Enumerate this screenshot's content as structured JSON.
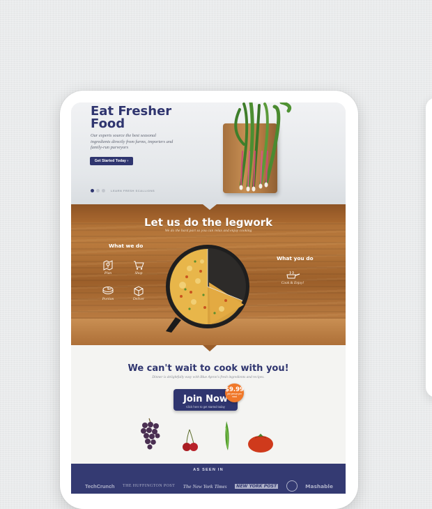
{
  "hero": {
    "title": "Eat Fresher Food",
    "subtitle": "Our experts source the best seasonal ingredients directly from farms, importers and family-run purveyors",
    "cta_label": "Get Started Today ›",
    "carousel_label": "LEARN FRESH SCALLIONS"
  },
  "legwork": {
    "title": "Let us do the legwork",
    "subtitle": "We do the hard part so you can relax and enjoy cooking",
    "we_do_title": "What we do",
    "you_do_title": "What you do",
    "we_do_steps": [
      {
        "label": "Plan",
        "icon": "map-pin-icon"
      },
      {
        "label": "Shop",
        "icon": "cart-icon"
      },
      {
        "label": "Portion",
        "icon": "portion-icon"
      },
      {
        "label": "Deliver",
        "icon": "box-icon"
      }
    ],
    "you_do_step": {
      "label": "Cook & Enjoy!",
      "icon": "pan-icon"
    }
  },
  "signup": {
    "title": "We can't wait to cook with you!",
    "subtitle": "Dinner is delightfully easy with Blue Apron's fresh ingredients and recipes.",
    "join_label": "Join Now",
    "join_sub": "Click here to get started today",
    "price": "$9.99",
    "price_note": "per person per meal"
  },
  "press": {
    "title": "AS SEEN IN",
    "logos": [
      "TechCrunch",
      "THE HUFFINGTON POST",
      "The New York Times",
      "NEW YORK POST",
      "Mashable"
    ]
  },
  "colors": {
    "brand_navy": "#2f356f",
    "price_orange": "#f0782a",
    "wood": "#a5672f"
  }
}
